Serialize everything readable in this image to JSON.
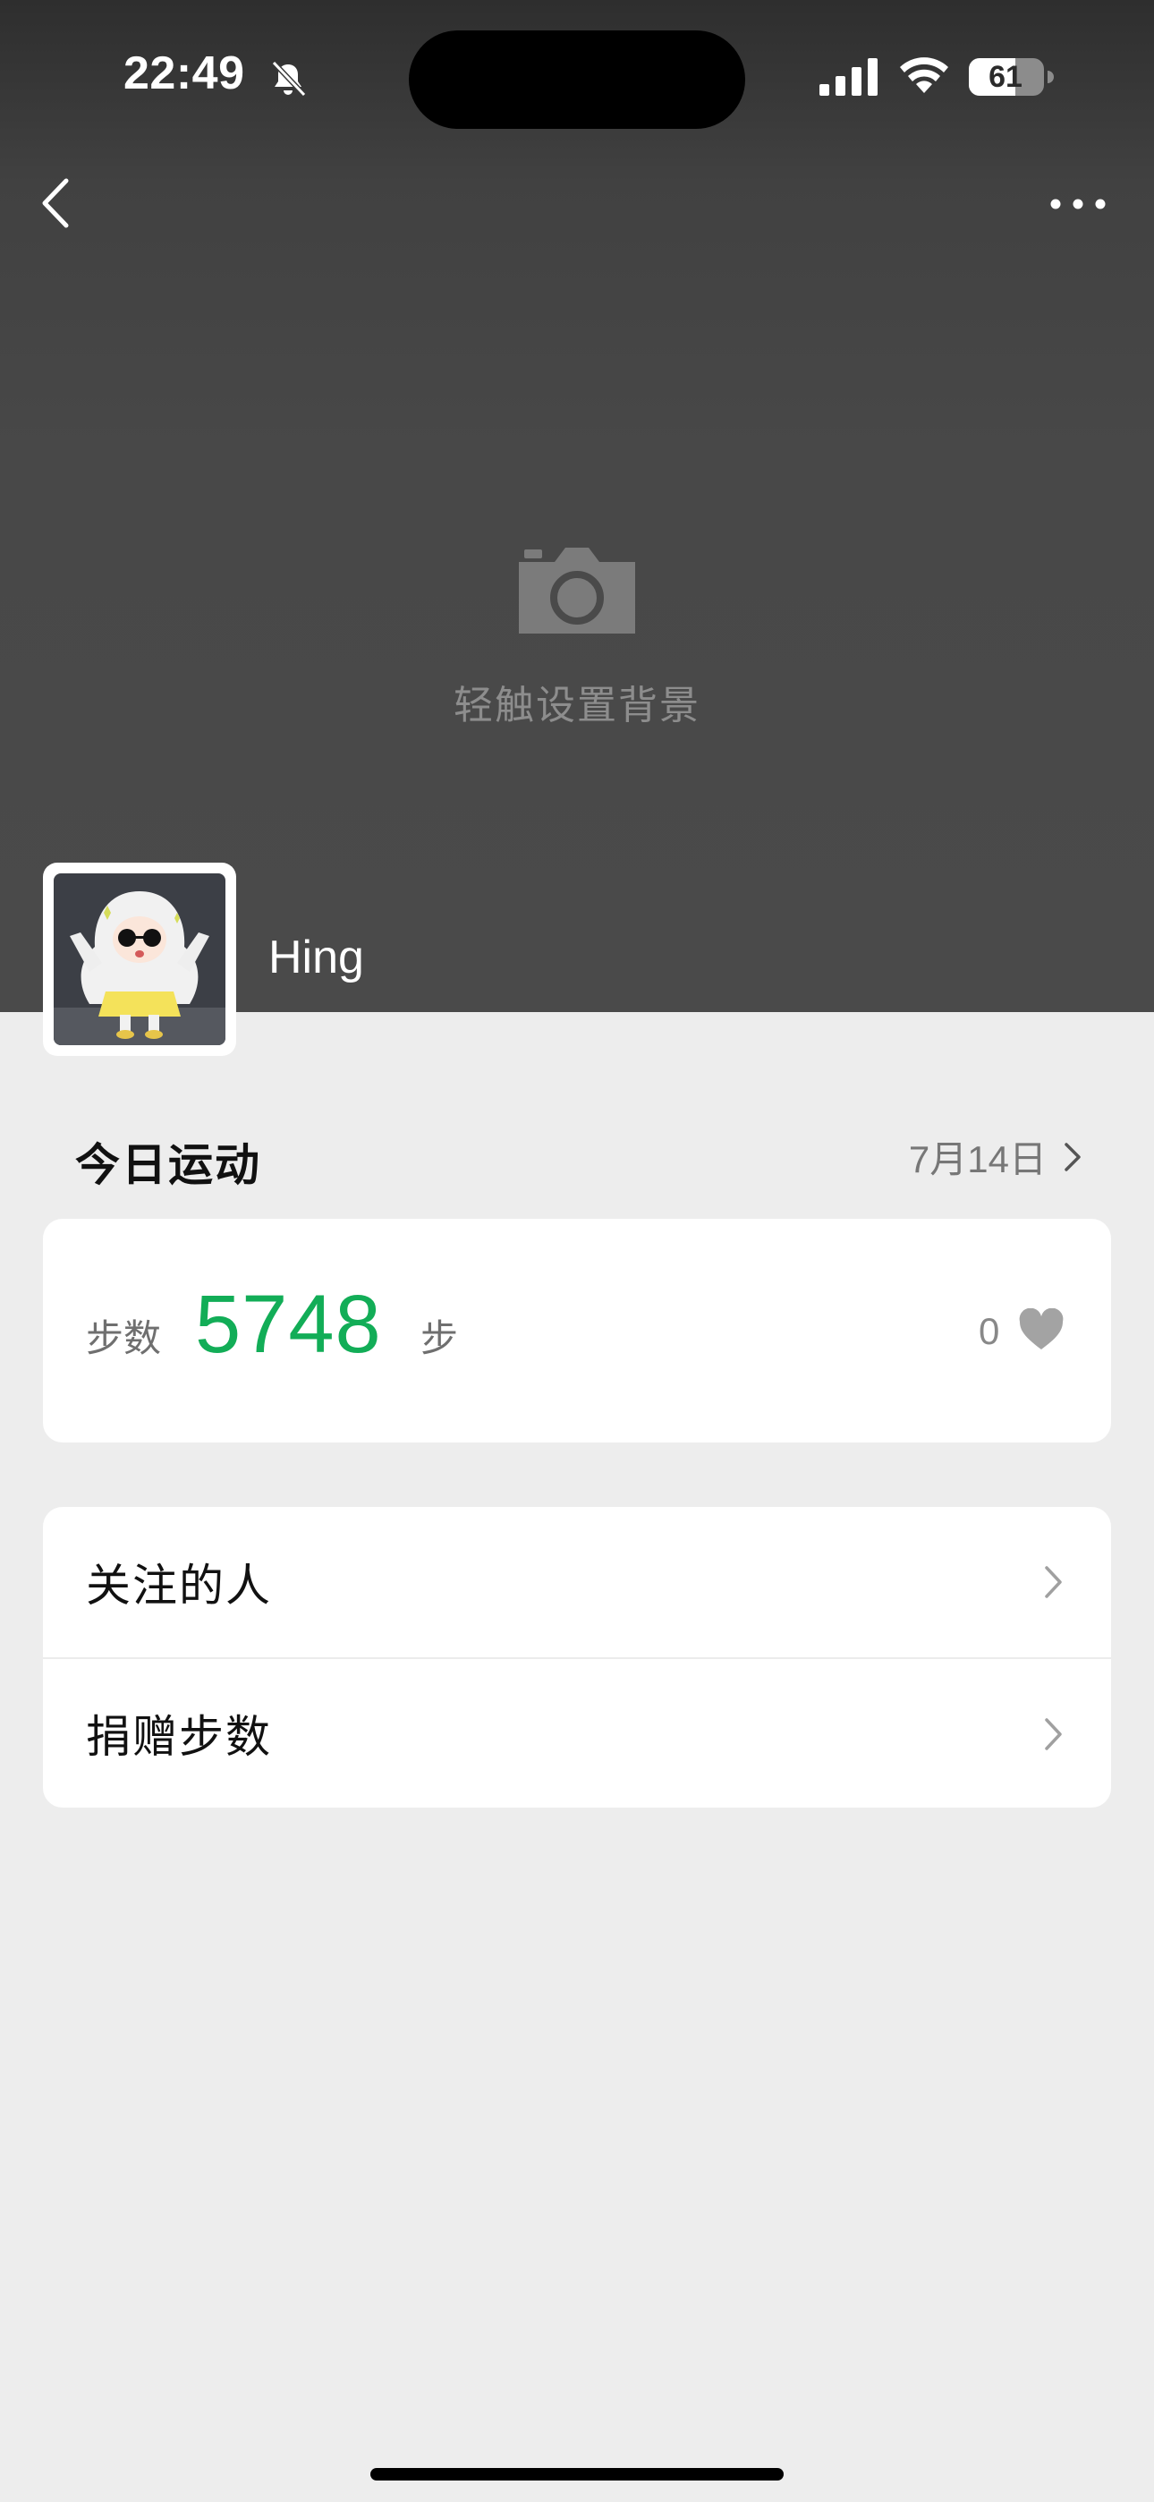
{
  "status_bar": {
    "time": "22:49",
    "battery": "61"
  },
  "cover": {
    "set_background_text": "轻触设置背景"
  },
  "profile": {
    "name": "Hing"
  },
  "today": {
    "title": "今日运动",
    "date": "7月14日"
  },
  "steps": {
    "label": "步数",
    "value": "5748",
    "unit": "步",
    "likes": "0",
    "accent_color": "#12ad57"
  },
  "menu": {
    "items": [
      {
        "label": "关注的人"
      },
      {
        "label": "捐赠步数"
      }
    ]
  },
  "icons": [
    "bell-slash-icon",
    "signal-icon",
    "wifi-icon",
    "battery-icon",
    "back-icon",
    "more-icon",
    "camera-icon",
    "heart-icon",
    "chevron-right-icon"
  ]
}
